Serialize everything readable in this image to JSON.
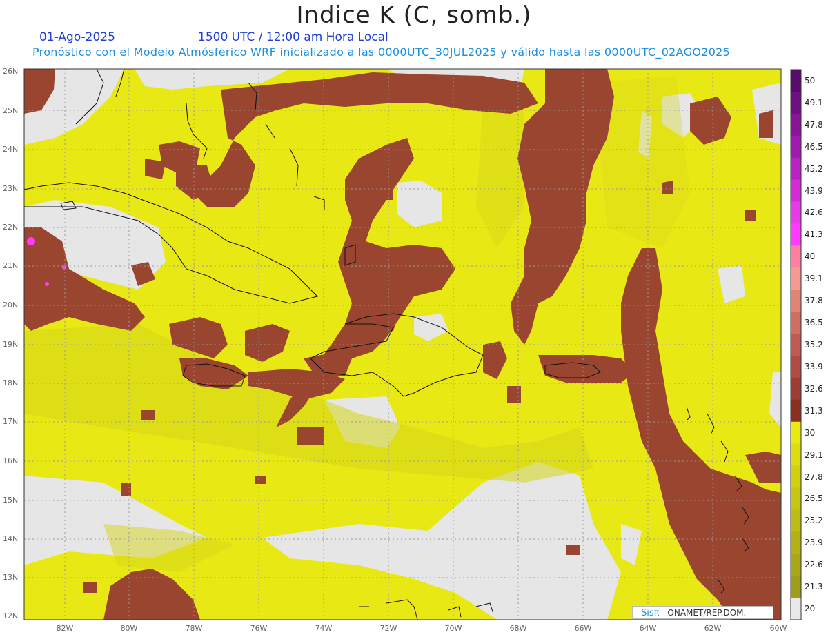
{
  "header": {
    "title": "Indice K (C, somb.)",
    "date": "01-Ago-2025",
    "time": "1500 UTC / 12:00 am Hora Local",
    "model_line": "Pronóstico con el Modelo Atmósferico WRF inicializado a las 0000UTC_30JUL2025 y válido hasta las  0000UTC_02AGO2025"
  },
  "axes": {
    "lat_labels": [
      "26N",
      "25N",
      "24N",
      "23N",
      "22N",
      "21N",
      "20N",
      "19N",
      "18N",
      "17N",
      "16N",
      "15N",
      "14N",
      "13N",
      "12N"
    ],
    "lon_labels": [
      "82W",
      "80W",
      "78W",
      "76W",
      "74W",
      "72W",
      "70W",
      "68W",
      "66W",
      "64W",
      "62W",
      "60W"
    ]
  },
  "colorbar": {
    "levels": [
      "50",
      "49.1",
      "47.8",
      "46.5",
      "45.2",
      "43.9",
      "42.6",
      "41.3",
      "40",
      "39.1",
      "37.8",
      "36.5",
      "35.2",
      "33.9",
      "32.6",
      "31.3",
      "30",
      "29.1",
      "27.8",
      "26.5",
      "25.2",
      "23.9",
      "22.6",
      "21.3",
      "20"
    ],
    "colors": [
      "#5a0a6a",
      "#6e0f82",
      "#8a1498",
      "#a01aaf",
      "#bb22c5",
      "#d42bd8",
      "#e83ae8",
      "#ff3bff",
      "#ff7fa0",
      "#f49a92",
      "#e08478",
      "#d06e64",
      "#c05a52",
      "#b04a42",
      "#9e3b34",
      "#8b2f22",
      "#e8ea10",
      "#dcdc10",
      "#d0d012",
      "#c6c612",
      "#bcbc14",
      "#b2b216",
      "#a8a818",
      "#9e9e1a",
      "#e8e8e8"
    ]
  },
  "credit": {
    "brand": "Sisπ",
    "text": " - ONAMET/REP.DOM."
  }
}
